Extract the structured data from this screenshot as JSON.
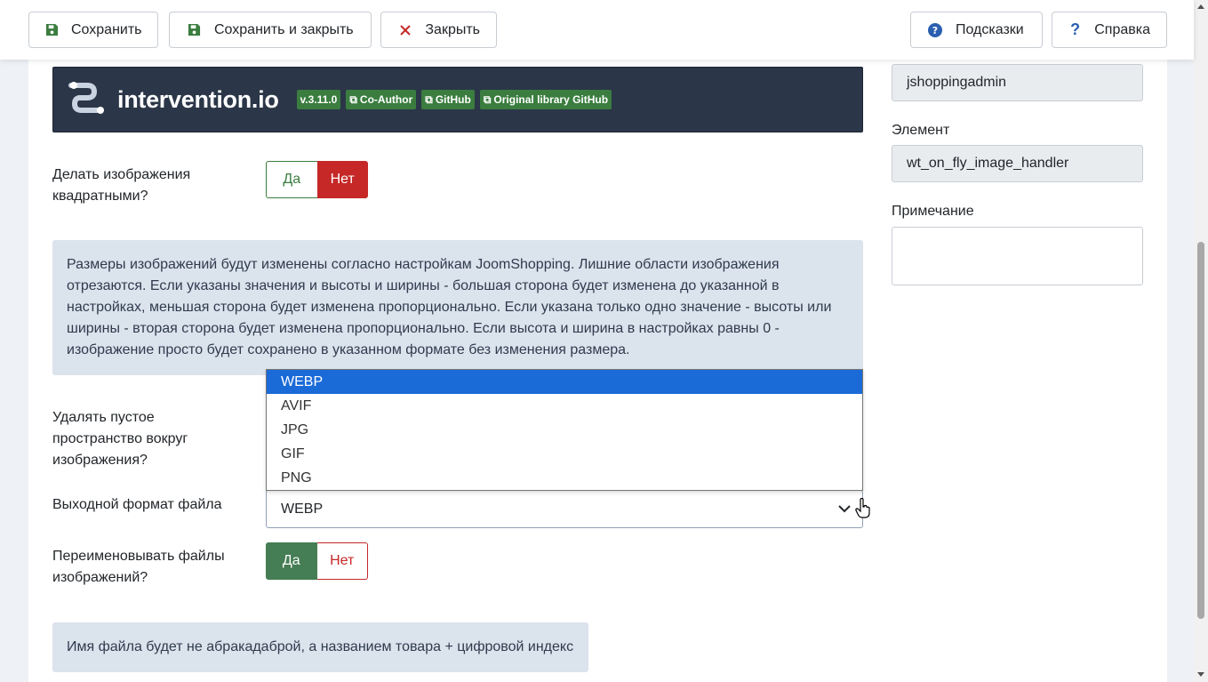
{
  "toolbar": {
    "save": "Сохранить",
    "save_close": "Сохранить и закрыть",
    "close": "Закрыть",
    "hints": "Подсказки",
    "help": "Справка"
  },
  "banner": {
    "logo": "intervention.io",
    "version": "v.3.11.0",
    "coauthor": "Co-Author",
    "github": "GitHub",
    "orig_github": "Original library GitHub"
  },
  "square": {
    "label": "Делать изображения квадратными?",
    "yes": "Да",
    "no": "Нет",
    "value": "Нет"
  },
  "info_resize": "Размеры изображений будут изменены согласно настройкам JoomShopping. Лишние области изображения отрезаются. Если указаны значения и высоты и ширины - большая сторона будет изменена до указанной в настройках, меньшая сторона будет изменена пропорционально. Если указана только одно значение - высоты или ширины - вторая сторона будет изменена пропорционально. Если высота и ширина в настройках равны 0 - изображение просто будет сохранено в указанном формате без изменения размера.",
  "trim": {
    "label": "Удалять пустое пространство вокруг изображения?"
  },
  "format": {
    "label": "Выходной формат файла",
    "value": "WEBP",
    "options": [
      "WEBP",
      "AVIF",
      "JPG",
      "GIF",
      "PNG"
    ]
  },
  "rename": {
    "label": "Переименовывать файлы изображений?",
    "yes": "Да",
    "no": "Нет",
    "value": "Да"
  },
  "info_rename": "Имя файла будет не абракадаброй, а названием товара + цифровой индекс",
  "sidebar": {
    "folder_value": "jshoppingadmin",
    "element_label": "Элемент",
    "element_value": "wt_on_fly_image_handler",
    "note_label": "Примечание",
    "note_value": ""
  },
  "colors": {
    "accent_green": "#457d54",
    "danger_red": "#c52827",
    "selected_blue": "#1a6ad8",
    "banner_bg": "#2b3648",
    "info_bg": "#dbe3ed"
  }
}
